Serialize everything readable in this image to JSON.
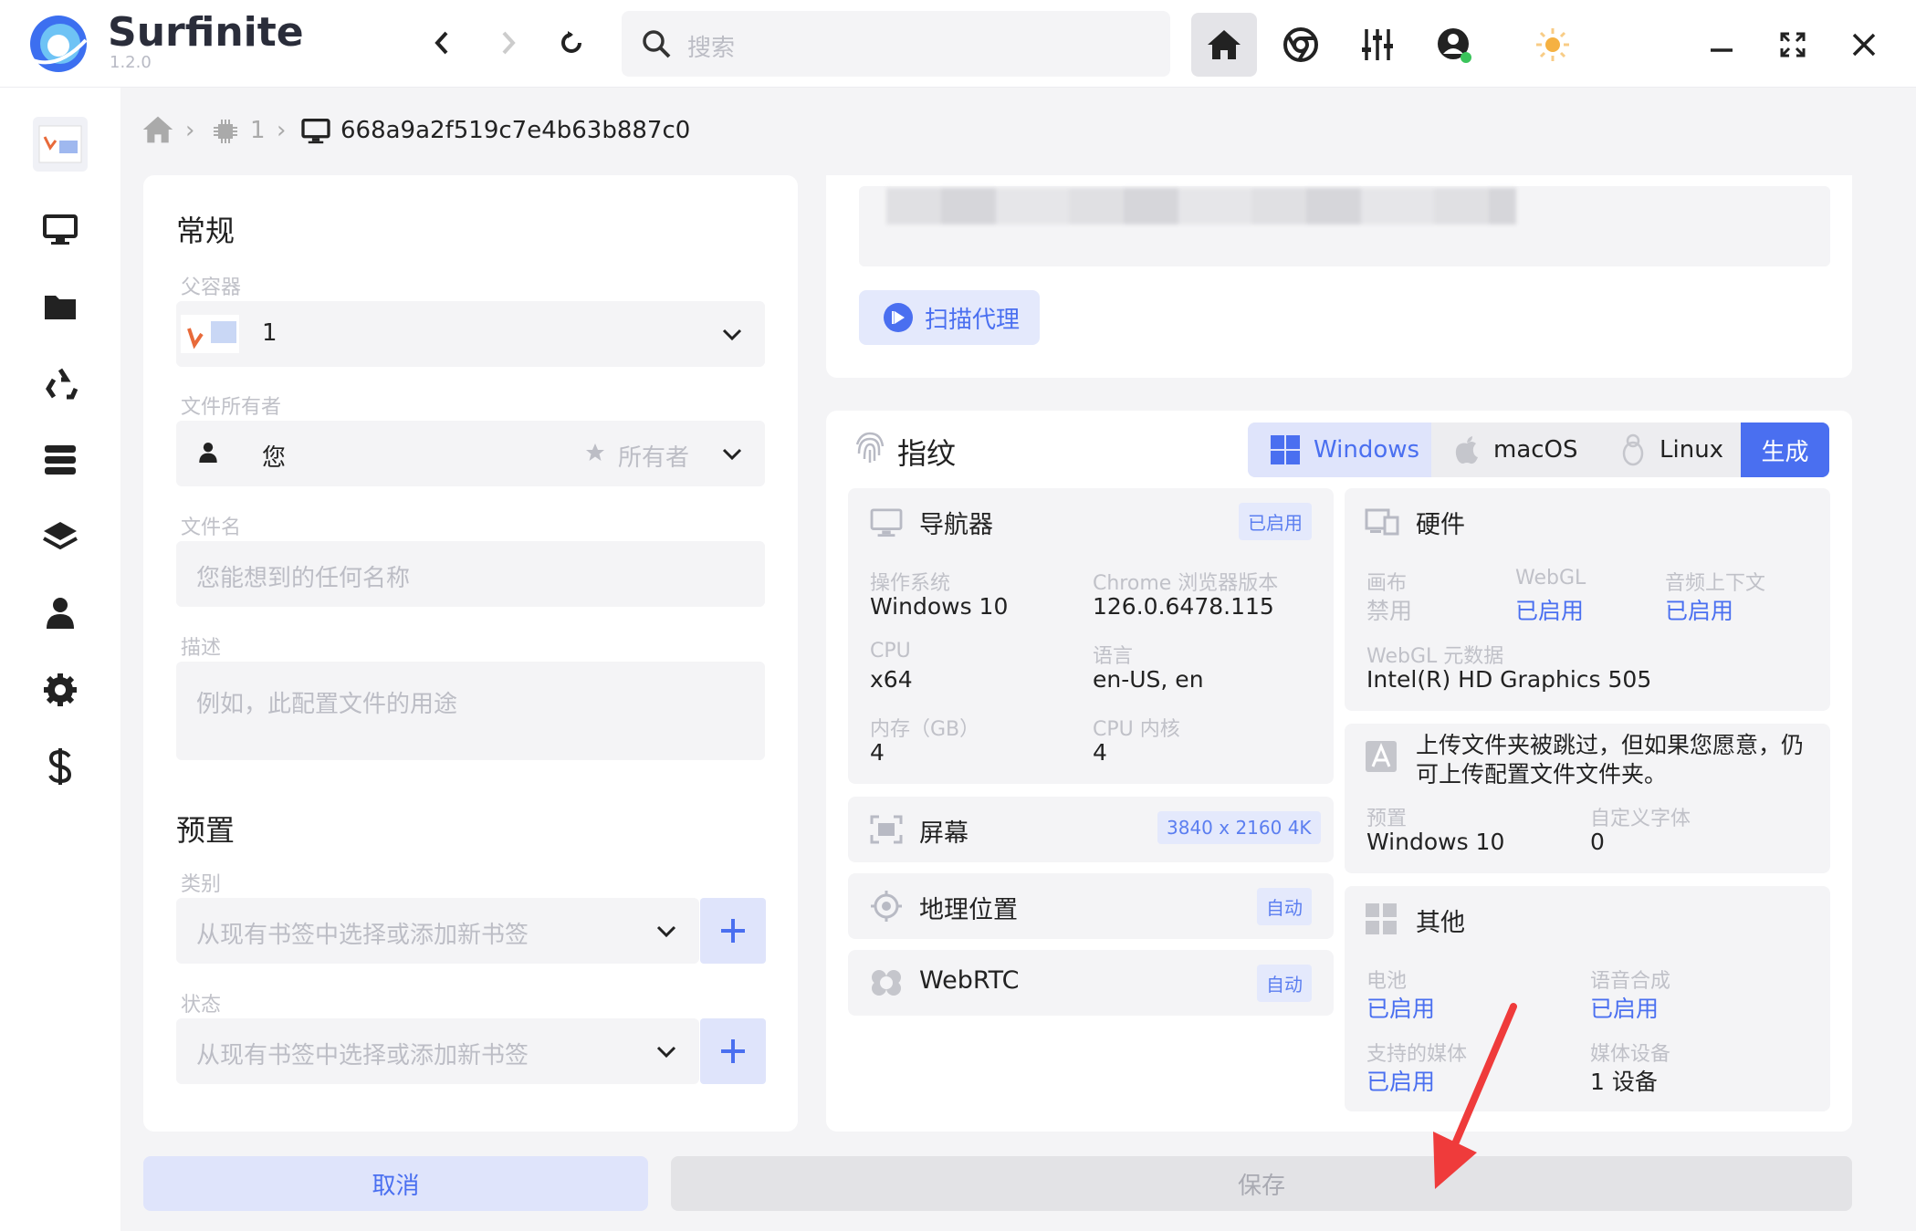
{
  "app": {
    "name": "Surfinite",
    "version": "1.2.0"
  },
  "search": {
    "placeholder": "搜索"
  },
  "breadcrumb": {
    "folder": "1",
    "profile_id": "668a9a2f519c7e4b63b887c0"
  },
  "general": {
    "title": "常规",
    "parent_label": "父容器",
    "parent_value": "1",
    "owner_label": "文件所有者",
    "owner_value": "您",
    "owner_role": "所有者",
    "filename_label": "文件名",
    "filename_placeholder": "您能想到的任何名称",
    "desc_label": "描述",
    "desc_placeholder": "例如，此配置文件的用途"
  },
  "preset": {
    "title": "预置",
    "category_label": "类别",
    "category_placeholder": "从现有书签中选择或添加新书签",
    "status_label": "状态",
    "status_placeholder": "从现有书签中选择或添加新书签"
  },
  "proxy": {
    "scan_button": "扫描代理"
  },
  "fingerprint": {
    "title": "指纹",
    "tabs": [
      "Windows",
      "macOS",
      "Linux"
    ],
    "generate": "生成",
    "navigator": {
      "title": "导航器",
      "badge": "已启用",
      "os_label": "操作系统",
      "os": "Windows 10",
      "browser_label": "Chrome 浏览器版本",
      "browser": "126.0.6478.115",
      "cpu_label": "CPU",
      "cpu": "x64",
      "lang_label": "语言",
      "lang": "en-US, en",
      "mem_label": "内存（GB）",
      "mem": "4",
      "cores_label": "CPU 内核",
      "cores": "4"
    },
    "screen": {
      "title": "屏幕",
      "badge": "3840 x 2160 4K"
    },
    "geo": {
      "title": "地理位置",
      "badge": "自动"
    },
    "webrtc": {
      "title": "WebRTC",
      "badge": "自动"
    },
    "hardware": {
      "title": "硬件",
      "canvas_label": "画布",
      "canvas": "禁用",
      "webgl_label": "WebGL",
      "webgl": "已启用",
      "audio_label": "音频上下文",
      "audio": "已启用",
      "meta_label": "WebGL 元数据",
      "meta": "Intel(R) HD Graphics 505"
    },
    "fonts": {
      "note": "上传文件夹被跳过，但如果您愿意，仍可上传配置文件文件夹。",
      "preset_label": "预置",
      "preset": "Windows 10",
      "custom_label": "自定义字体",
      "custom": "0"
    },
    "other": {
      "title": "其他",
      "battery_label": "电池",
      "battery": "已启用",
      "speech_label": "语音合成",
      "speech": "已启用",
      "media_label": "支持的媒体",
      "media": "已启用",
      "devices_label": "媒体设备",
      "devices": "1 设备"
    }
  },
  "actions": {
    "cancel": "取消",
    "save": "保存"
  }
}
